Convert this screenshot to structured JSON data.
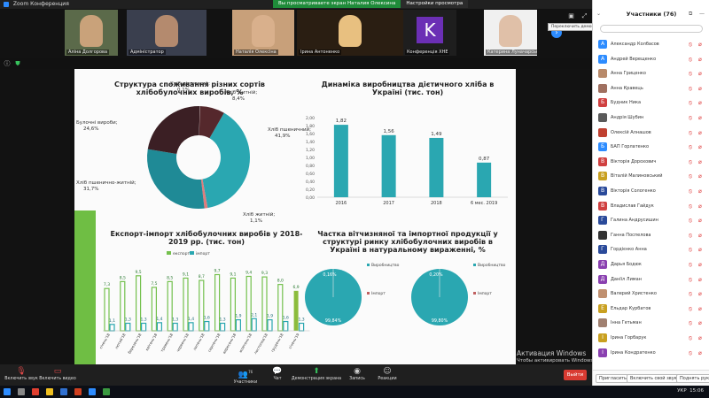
{
  "window": {
    "title": "Zoom Конференция"
  },
  "share_banner": {
    "label": "Вы просматриваете экран Наталия Олексина",
    "options": "Настройки просмотра"
  },
  "strip": {
    "tiles": [
      {
        "name": "Аліна Долгорова",
        "kind": "face",
        "color": "#c9a27a",
        "bg": "#5b6a4a"
      },
      {
        "name": "Адміністратор",
        "kind": "face",
        "color": "#b48a6e",
        "bg": "#3a3f4e"
      },
      {
        "name": "",
        "kind": "face",
        "color": "#bda084",
        "bg": "#8b4a3a"
      },
      {
        "name": "Наталія Олексіна",
        "kind": "face",
        "color": "#d9b08c",
        "bg": "#c8a07a"
      },
      {
        "name": "Ірина Антоненко",
        "kind": "face",
        "color": "#e8c080",
        "bg": "#2a1e12"
      },
      {
        "name": "Конференція ХНЕ",
        "kind": "letter",
        "letter": "K",
        "bg": "#1e1e1e"
      },
      {
        "name": "Катерина Луначарська",
        "kind": "face",
        "color": "#e0c0a8",
        "bg": "#f0f0f0"
      }
    ],
    "tooltip": "Переключить демонстрацию экрана с видео"
  },
  "slide": {
    "pie": {
      "title": "Структура споживання різних сортів хлібобулочних виробів, %",
      "labels": [
        {
          "text": "Хліб житній;",
          "value": "8,4%"
        },
        {
          "text": "Хліб пшеничний;",
          "value": "41,9%"
        },
        {
          "text": "Хліб житній;",
          "value": "1,1%"
        },
        {
          "text": "Хліб пшенично-житній;",
          "value": "31,7%"
        },
        {
          "text": "Булочні вироби;",
          "value": "24,6%"
        },
        {
          "text": "Хліб дієтичний;",
          "value": "0,1%"
        }
      ]
    },
    "export_title": "Експорт-імпорт хлібобулочних виробів у 2018-2019 рр. (тис. тон)",
    "legend_export": "експорт",
    "legend_import": "імпорт",
    "line_title": "Динаміка виробництва дієтичного хліба в Україні (тис. тон)",
    "share_title": "Частка вітчизняної та імпортної продукції у структурі ринку хлібобулочних виробів в Україні в натуральному вираженні, %",
    "share_pies": [
      {
        "top": "0,16%",
        "bottom": "99,84%",
        "legend1": "Виробництво",
        "legend2": "Імпорт"
      },
      {
        "top": "0,20%",
        "bottom": "99,80%",
        "legend1": "Виробництво",
        "legend2": "Імпорт"
      }
    ]
  },
  "chart_data": [
    {
      "type": "pie",
      "title": "Структура споживання різних сортів хлібобулочних виробів, %",
      "categories": [
        "Хліб пшеничний",
        "Хліб житній",
        "Хліб пшенично-житній",
        "Булочні вироби",
        "Хліб дієтичний",
        "Хліб житній"
      ],
      "values": [
        41.9,
        1.1,
        31.7,
        24.6,
        0.1,
        8.4
      ],
      "colors": [
        "#2aa7b1",
        "#e07c7c",
        "#1f8a96",
        "#3b1f24",
        "#cccccc",
        "#55282c"
      ]
    },
    {
      "type": "bar",
      "title": "Динаміка виробництва дієтичного хліба в Україні (тис. тон)",
      "categories": [
        "2016",
        "2017",
        "2018",
        "6 мес. 2019"
      ],
      "values": [
        1.82,
        1.56,
        1.49,
        0.87
      ],
      "value_labels": [
        "1,82",
        "1,56",
        "1,49",
        "0,87"
      ],
      "ylim": [
        0,
        2.0
      ],
      "yticks": [
        "0,00",
        "0,20",
        "0,40",
        "0,60",
        "0,80",
        "1,00",
        "1,20",
        "1,40",
        "1,60",
        "1,80",
        "2,00"
      ]
    },
    {
      "type": "bar",
      "title": "Експорт-імпорт хлібобулочних виробів у 2018-2019 рр. (тис. тон)",
      "categories": [
        "січень'18",
        "лютий'18",
        "березень'18",
        "квітень'18",
        "травень'18",
        "червень'18",
        "липень'18",
        "серпень'18",
        "вересень'18",
        "жовтень'18",
        "листопад'18",
        "грудень'18",
        "січень'19"
      ],
      "series": [
        {
          "name": "експорт",
          "values": [
            7.3,
            8.5,
            9.5,
            7.5,
            8.5,
            9.1,
            8.7,
            9.7,
            9.1,
            9.4,
            9.3,
            8.0,
            6.9
          ],
          "labels": [
            "7,3",
            "8,5",
            "9,5",
            "7,5",
            "8,5",
            "9,1",
            "8,7",
            "9,7",
            "9,1",
            "9,4",
            "9,3",
            "8,0",
            "6,9"
          ]
        },
        {
          "name": "імпорт",
          "values": [
            1.1,
            1.3,
            1.3,
            1.4,
            1.3,
            1.4,
            1.6,
            1.3,
            1.9,
            2.1,
            1.9,
            1.6,
            1.3
          ],
          "labels": [
            "1,1",
            "1,3",
            "1,3",
            "1,4",
            "1,3",
            "1,4",
            "1,6",
            "1,3",
            "1,9",
            "2,1",
            "1,9",
            "1,6",
            "1,3"
          ]
        }
      ],
      "colors": {
        "export": "#74c04d",
        "export_last": "#8cbc3c",
        "import": "#2aa7b1"
      }
    }
  ],
  "watermark": {
    "line1": "Активация Windows",
    "line2": "Чтобы активировать Windows, перейдите в раздел..."
  },
  "toolbar": {
    "mute": "Включить звук",
    "video": "Включить видео",
    "participants": "Участники",
    "participants_count": "76",
    "chat": "Чат",
    "share": "Демонстрация экрана",
    "record": "Запись",
    "reactions": "Реакции",
    "end": "Выйти"
  },
  "panel": {
    "title": "Участники (76)",
    "participants": [
      {
        "name": "Александр Колбасов",
        "initial": "А",
        "color": "#2d8cff"
      },
      {
        "name": "Андрей Верещенко",
        "initial": "А",
        "color": "#2d8cff"
      },
      {
        "name": "Анна Гриценко",
        "initial": "",
        "color": "#b88a6a"
      },
      {
        "name": "Анна Кравець",
        "initial": "",
        "color": "#a07060"
      },
      {
        "name": "Будник Ника",
        "initial": "Б",
        "color": "#d04040"
      },
      {
        "name": "Андрія Шубин",
        "initial": "",
        "color": "#5a5a5a"
      },
      {
        "name": "Олексій Алнашов",
        "initial": "",
        "color": "#c04030"
      },
      {
        "name": "БАП Горлатенко",
        "initial": "Б",
        "color": "#2d8cff"
      },
      {
        "name": "Вікторія Дорохович",
        "initial": "В",
        "color": "#d04040"
      },
      {
        "name": "Віталій Малиновський",
        "initial": "В",
        "color": "#c9a020"
      },
      {
        "name": "Вікторія Сологенко",
        "initial": "В",
        "color": "#2a4a9a"
      },
      {
        "name": "Владислав Гайдук",
        "initial": "В",
        "color": "#d04040"
      },
      {
        "name": "Галина Андрусишин",
        "initial": "Г",
        "color": "#2a4a9a"
      },
      {
        "name": "Ганна Поспелова",
        "initial": "",
        "color": "#333"
      },
      {
        "name": "Гордієнко Анна",
        "initial": "Г",
        "color": "#2a4a9a"
      },
      {
        "name": "Дарья Бодюк",
        "initial": "Д",
        "color": "#8a40b0"
      },
      {
        "name": "Даніїл Лиман",
        "initial": "Д",
        "color": "#8a40b0"
      },
      {
        "name": "Валерий Христенко",
        "initial": "",
        "color": "#c09070"
      },
      {
        "name": "Ельдар Курбатов",
        "initial": "Е",
        "color": "#c9a020"
      },
      {
        "name": "Інна Гетьман",
        "initial": "",
        "color": "#a08070"
      },
      {
        "name": "Ірина Горбарук",
        "initial": "І",
        "color": "#c9a020"
      },
      {
        "name": "Ірина Кондратенко",
        "initial": "І",
        "color": "#8a40b0"
      }
    ],
    "invite": "Пригласить",
    "unmute_all": "Включить свой звук",
    "raise_hand": "Поднять руку"
  },
  "taskbar": {
    "lang": "УКР",
    "time": "15:06"
  }
}
